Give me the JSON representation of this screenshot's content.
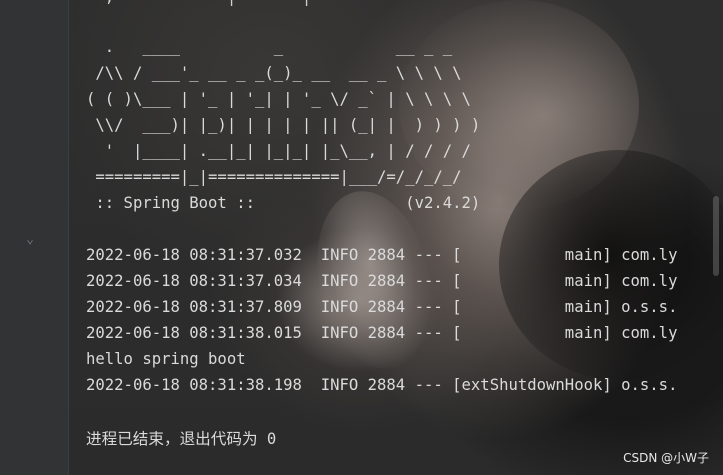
{
  "top_fragment": "  ,         '  | '-' ' |  '  '     ' ' '           ' ' ' '",
  "banner": [
    "  .   ____          _            __ _ _",
    " /\\\\ / ___'_ __ _ _(_)_ __  __ _ \\ \\ \\ \\",
    "( ( )\\___ | '_ | '_| | '_ \\/ _` | \\ \\ \\ \\",
    " \\\\/  ___)| |_)| | | | | || (_| |  ) ) ) )",
    "  '  |____| .__|_| |_|_| |_\\__, | / / / /",
    " =========|_|==============|___/=/_/_/_/",
    " :: Spring Boot ::                (v2.4.2)"
  ],
  "log_lines": [
    "2022-06-18 08:31:37.032  INFO 2884 --- [           main] com.ly",
    "2022-06-18 08:31:37.034  INFO 2884 --- [           main] com.ly",
    "2022-06-18 08:31:37.809  INFO 2884 --- [           main] o.s.s.",
    "2022-06-18 08:31:38.015  INFO 2884 --- [           main] com.ly",
    "hello spring boot",
    "2022-06-18 08:31:38.198  INFO 2884 --- [extShutdownHook] o.s.s."
  ],
  "exit_message": "进程已结束，退出代码为 0",
  "watermark": "CSDN @小W子"
}
